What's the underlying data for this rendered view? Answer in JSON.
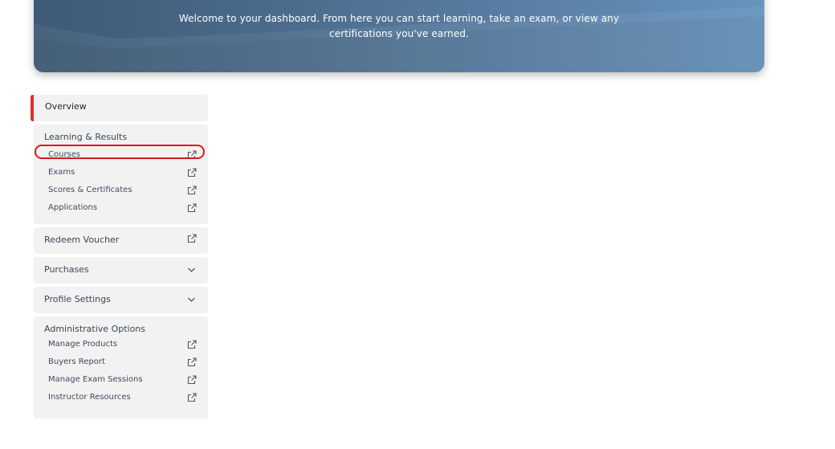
{
  "hero": {
    "message": "Welcome to your dashboard. From here you can start learning, take an exam, or view any certifications you've earned."
  },
  "sidebar": {
    "overview": "Overview",
    "learning": {
      "title": "Learning & Results",
      "items": [
        "Courses",
        "Exams",
        "Scores & Certificates",
        "Applications"
      ]
    },
    "redeem": "Redeem Voucher",
    "purchases": "Purchases",
    "profile": "Profile Settings",
    "admin": {
      "title": "Administrative Options",
      "items": [
        "Manage Products",
        "Buyers Report",
        "Manage Exam Sessions",
        "Instructor Resources"
      ]
    }
  },
  "colors": {
    "accent": "#d8322e",
    "hero_start": "#3d5a76",
    "hero_end": "#6594bc",
    "card_bg": "#f2f2f2"
  },
  "icons": {
    "external": "external-link-icon",
    "chevron": "chevron-down-icon"
  }
}
